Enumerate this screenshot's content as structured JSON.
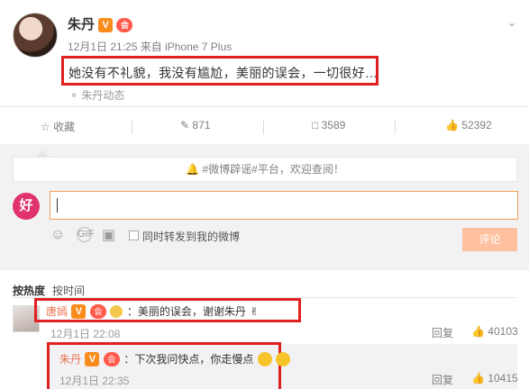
{
  "post": {
    "author": "朱丹",
    "verified_badge": "V",
    "vip_badge": "会",
    "time": "12月1日 21:25",
    "source_prefix": "来自",
    "device": "iPhone 7 Plus",
    "text": "她没有不礼貌，我没有尴尬，美丽的误会，一切很好…",
    "origin_link": "朱丹动态"
  },
  "actions": {
    "favorite_label": "收藏",
    "repost_count": "871",
    "comment_count": "3589",
    "like_count": "52392"
  },
  "comment_box": {
    "notice": "#微博辟谣#平台，欢迎查阅！",
    "notice_icon": "bell-icon",
    "input_value": "",
    "also_repost_label": "同时转发到我的微博",
    "submit_label": "评论",
    "avatar_text": "好"
  },
  "sort": {
    "hot_label": "按热度",
    "time_label": "按时间"
  },
  "comments": [
    {
      "author": "唐嫣",
      "text": "：美丽的误会，谢谢朱丹",
      "time": "12月1日 22:08",
      "reply_label": "回复",
      "likes": "40103",
      "reply": {
        "author": "朱丹",
        "text": "：下次我问快点，你走慢点",
        "time": "12月1日 22:35",
        "reply_label": "回复",
        "likes": "10415"
      }
    }
  ],
  "colors": {
    "highlight": "#e02020",
    "link": "#eb7350",
    "submit_bg": "#ffc09f",
    "input_border": "#f5a05a"
  }
}
